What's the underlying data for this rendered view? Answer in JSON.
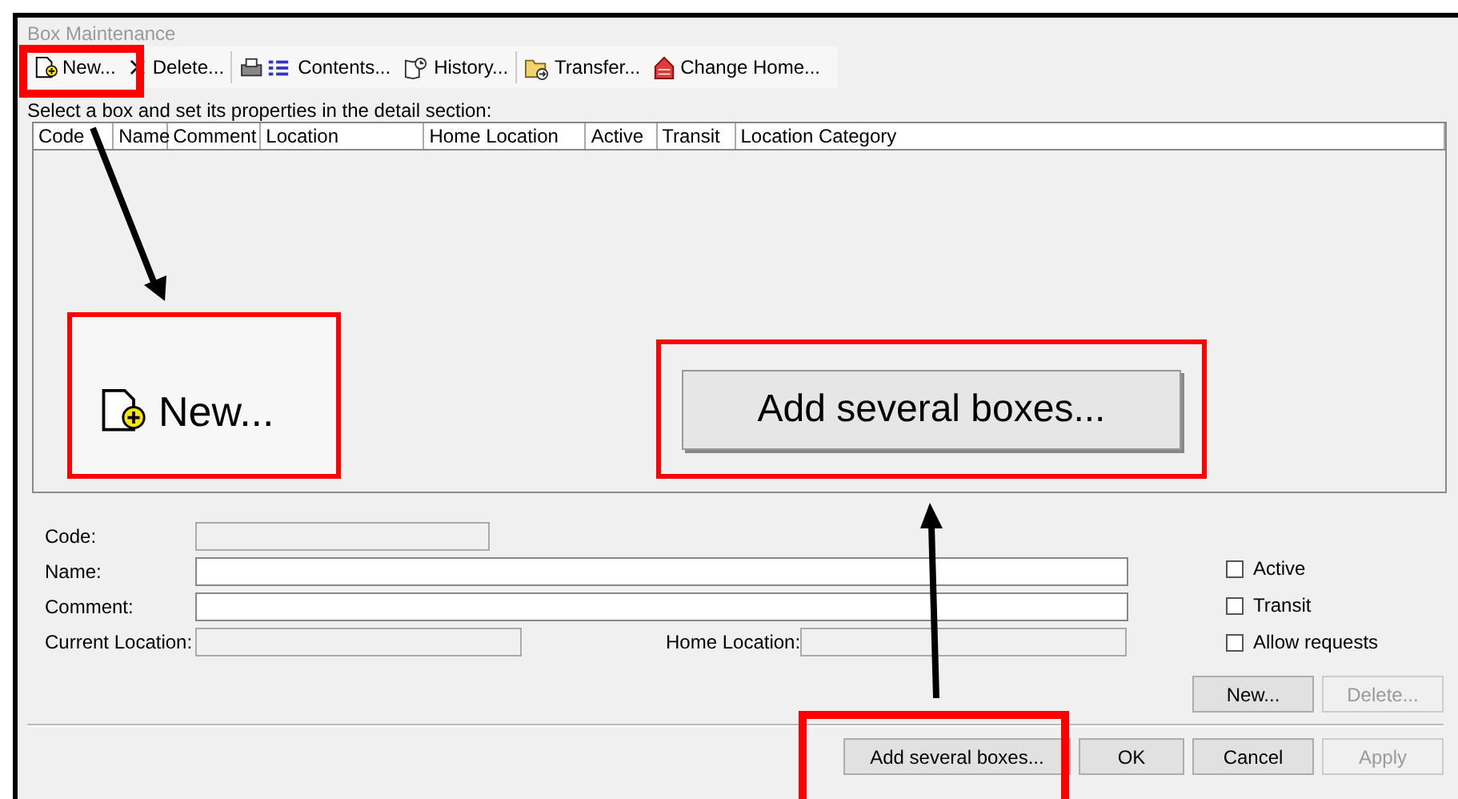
{
  "window": {
    "title": "Box Maintenance"
  },
  "toolbar": [
    {
      "label": "New...",
      "disabled": false
    },
    {
      "label": "Delete...",
      "disabled": false
    },
    {
      "label": "Contents...",
      "disabled": false
    },
    {
      "label": "History...",
      "disabled": false
    },
    {
      "label": "Transfer...",
      "disabled": false
    },
    {
      "label": "Change Home...",
      "disabled": false
    }
  ],
  "instruction": "Select a box and set its properties in the detail section:",
  "table": {
    "columns": [
      "Code",
      "Name",
      "Comment",
      "Location",
      "Home Location",
      "Active",
      "Transit",
      "Location Category"
    ]
  },
  "form": {
    "code": {
      "label": "Code:",
      "disabled": true
    },
    "name": {
      "label": "Name:",
      "disabled": false
    },
    "comment": {
      "label": "Comment:",
      "disabled": false
    },
    "current_location": {
      "label": "Current Location:",
      "disabled": true
    },
    "home_location": {
      "label": "Home Location:",
      "disabled": true
    }
  },
  "checkboxes": [
    {
      "label": "Active",
      "checked": false
    },
    {
      "label": "Transit",
      "checked": false
    },
    {
      "label": "Allow requests",
      "checked": false
    }
  ],
  "detail_buttons": [
    {
      "label": "New...",
      "disabled": false
    },
    {
      "label": "Delete...",
      "disabled": true
    }
  ],
  "dialog_buttons": [
    {
      "label": "Add several boxes...",
      "disabled": false
    },
    {
      "label": "OK",
      "disabled": false
    },
    {
      "label": "Cancel",
      "disabled": false
    },
    {
      "label": "Apply",
      "disabled": true
    }
  ],
  "callouts": {
    "new_zoom": {
      "label": "New..."
    },
    "add_zoom": {
      "label": "Add several boxes..."
    }
  }
}
